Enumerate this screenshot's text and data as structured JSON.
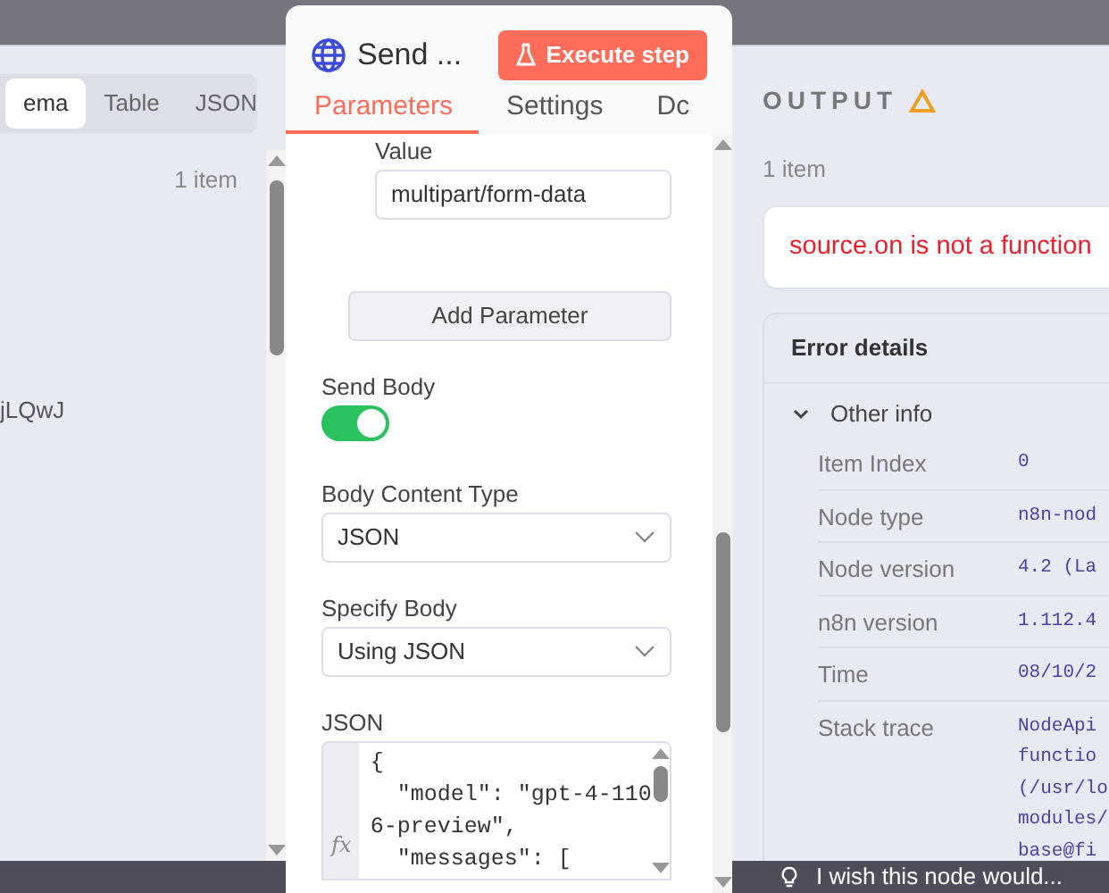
{
  "input_panel": {
    "view_tabs": [
      {
        "label": "ema",
        "selected": true
      },
      {
        "label": "Table",
        "selected": false
      },
      {
        "label": "JSON",
        "selected": false
      }
    ],
    "item_count": "1 item",
    "field_value": "jLQwJ"
  },
  "node_panel": {
    "title": "Send ...",
    "execute_button": "Execute step",
    "tabs": [
      {
        "label": "Parameters",
        "selected": true
      },
      {
        "label": "Settings",
        "selected": false
      },
      {
        "label": "Dc",
        "selected": false
      }
    ],
    "fields": [
      {
        "kind": "text",
        "label": "Value",
        "value": "multipart/form-data"
      },
      {
        "kind": "button",
        "label": "Add Parameter"
      },
      {
        "kind": "toggle",
        "label": "Send Body",
        "on": true
      },
      {
        "kind": "select",
        "label": "Body Content Type",
        "value": "JSON"
      },
      {
        "kind": "select",
        "label": "Specify Body",
        "value": "Using JSON"
      },
      {
        "kind": "code",
        "label": "JSON",
        "gutter": "fx",
        "lines": [
          "{",
          "  \"model\": \"gpt-4-110",
          "6-preview\",",
          "  \"messages\": ["
        ]
      }
    ]
  },
  "output_panel": {
    "title": "OUTPUT",
    "item_count": "1 item",
    "error_message": "source.on is not a function",
    "details": {
      "title": "Error details",
      "section": {
        "title": "Other info",
        "expanded": true,
        "rows": [
          {
            "label": "Item Index",
            "lines": [
              "0"
            ]
          },
          {
            "label": "Node type",
            "lines": [
              "n8n-nod"
            ]
          },
          {
            "label": "Node version",
            "lines": [
              "4.2 (La"
            ]
          },
          {
            "label": "n8n version",
            "lines": [
              "1.112.4"
            ]
          },
          {
            "label": "Time",
            "lines": [
              "08/10/2"
            ]
          },
          {
            "label": "Stack trace",
            "lines": [
              "NodeApi",
              "functio",
              "(/usr/lo",
              "modules/",
              "base@fi"
            ]
          }
        ]
      }
    }
  },
  "footer": {
    "feedback": "I wish this node would..."
  }
}
